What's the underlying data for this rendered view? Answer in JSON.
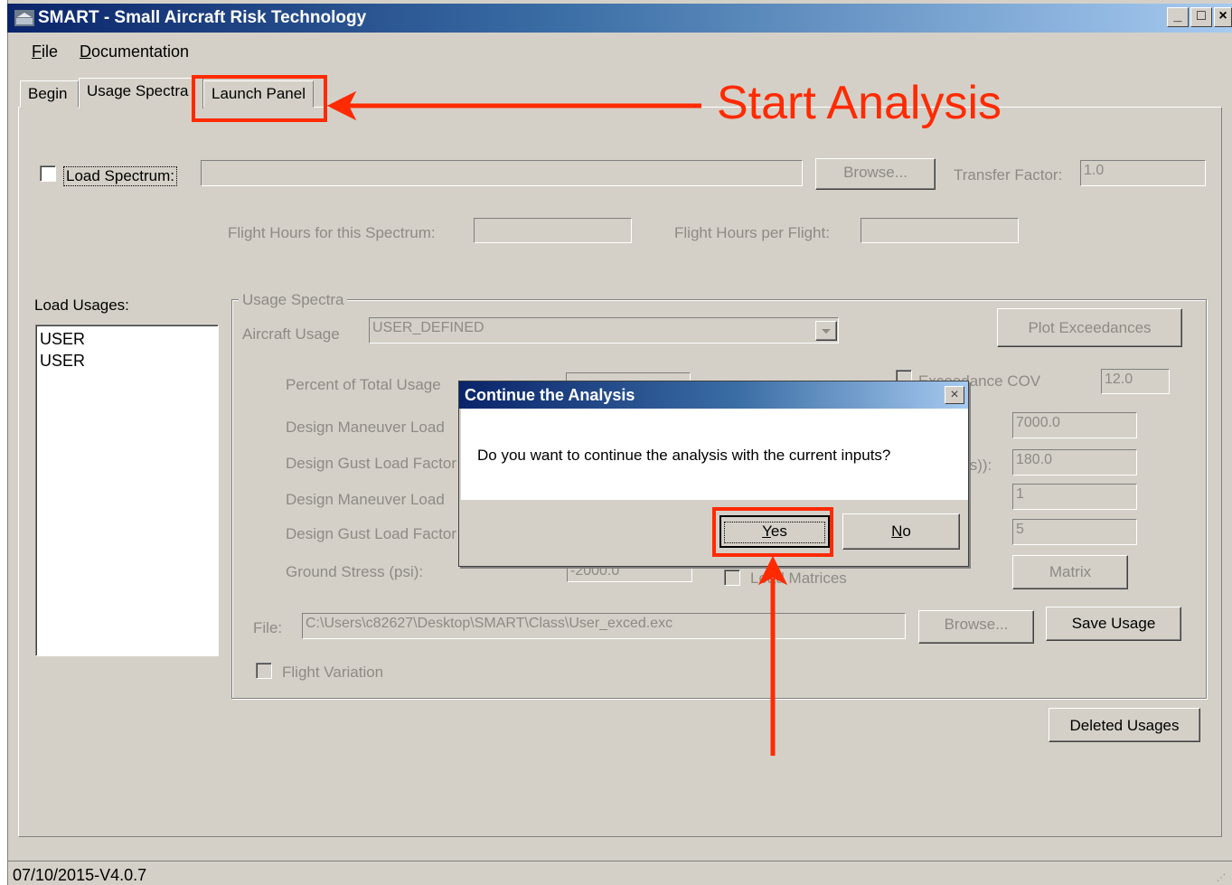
{
  "window": {
    "title": "SMART - Small Aircraft Risk Technology",
    "minimize": "_",
    "maximize": "□",
    "close": "×"
  },
  "menu": [
    {
      "mnemonic": "F",
      "rest": "ile"
    },
    {
      "mnemonic": "D",
      "rest": "ocumentation"
    }
  ],
  "tabs": [
    "Begin",
    "Usage Spectra",
    "Launch Panel"
  ],
  "spectrum": {
    "load_spectrum_label": "Load Spectrum:",
    "browse_label": "Browse...",
    "transfer_factor_label": "Transfer Factor:",
    "transfer_factor_value": "1.0",
    "flight_hours_spectrum_label": "Flight Hours for this Spectrum:",
    "flight_hours_per_flight_label": "Flight Hours per Flight:"
  },
  "load_usages": {
    "label": "Load Usages:",
    "items": [
      "USER",
      "USER"
    ]
  },
  "usage_spectra": {
    "group_title": "Usage Spectra",
    "aircraft_usage_label": "Aircraft Usage",
    "aircraft_usage_value": "USER_DEFINED",
    "plot_exceedances_label": "Plot Exceedances",
    "percent_total_usage_label": "Percent of Total Usage",
    "exceedance_cov_label": "Exceedance COV",
    "exceedance_cov_value": "12.0",
    "design_maneuver_load_label_1": "Design Maneuver Load",
    "value_1": "7000.0",
    "design_gust_load_label_1": "Design Gust Load Factor",
    "right_label_2": "ts)):",
    "value_2": "180.0",
    "design_maneuver_load_label_2": "Design Maneuver Load",
    "value_3": "1",
    "design_gust_load_label_2": "Design Gust Load Factor",
    "value_4": "5",
    "ground_stress_label": "Ground Stress (psi):",
    "ground_stress_value": "-2000.0",
    "load_matrices_label": "Load Matrices",
    "matrix_label": "Matrix",
    "file_label": "File:",
    "file_path": "C:\\Users\\c82627\\Desktop\\SMART\\Class\\User_exced.exc",
    "browse_label": "Browse...",
    "save_usage_label": "Save Usage",
    "flight_variation_label": "Flight Variation"
  },
  "deleted_usages_label": "Deleted Usages",
  "status_bar": "07/10/2015-V4.0.7",
  "dialog": {
    "title": "Continue the Analysis",
    "close": "×",
    "message": "Do you want to continue the analysis with the current inputs?",
    "yes": {
      "mnemonic": "Y",
      "rest": "es"
    },
    "no": {
      "mnemonic": "N",
      "rest": "o"
    }
  },
  "annotation": {
    "text": "Start Analysis",
    "color": "#ff2a00"
  }
}
